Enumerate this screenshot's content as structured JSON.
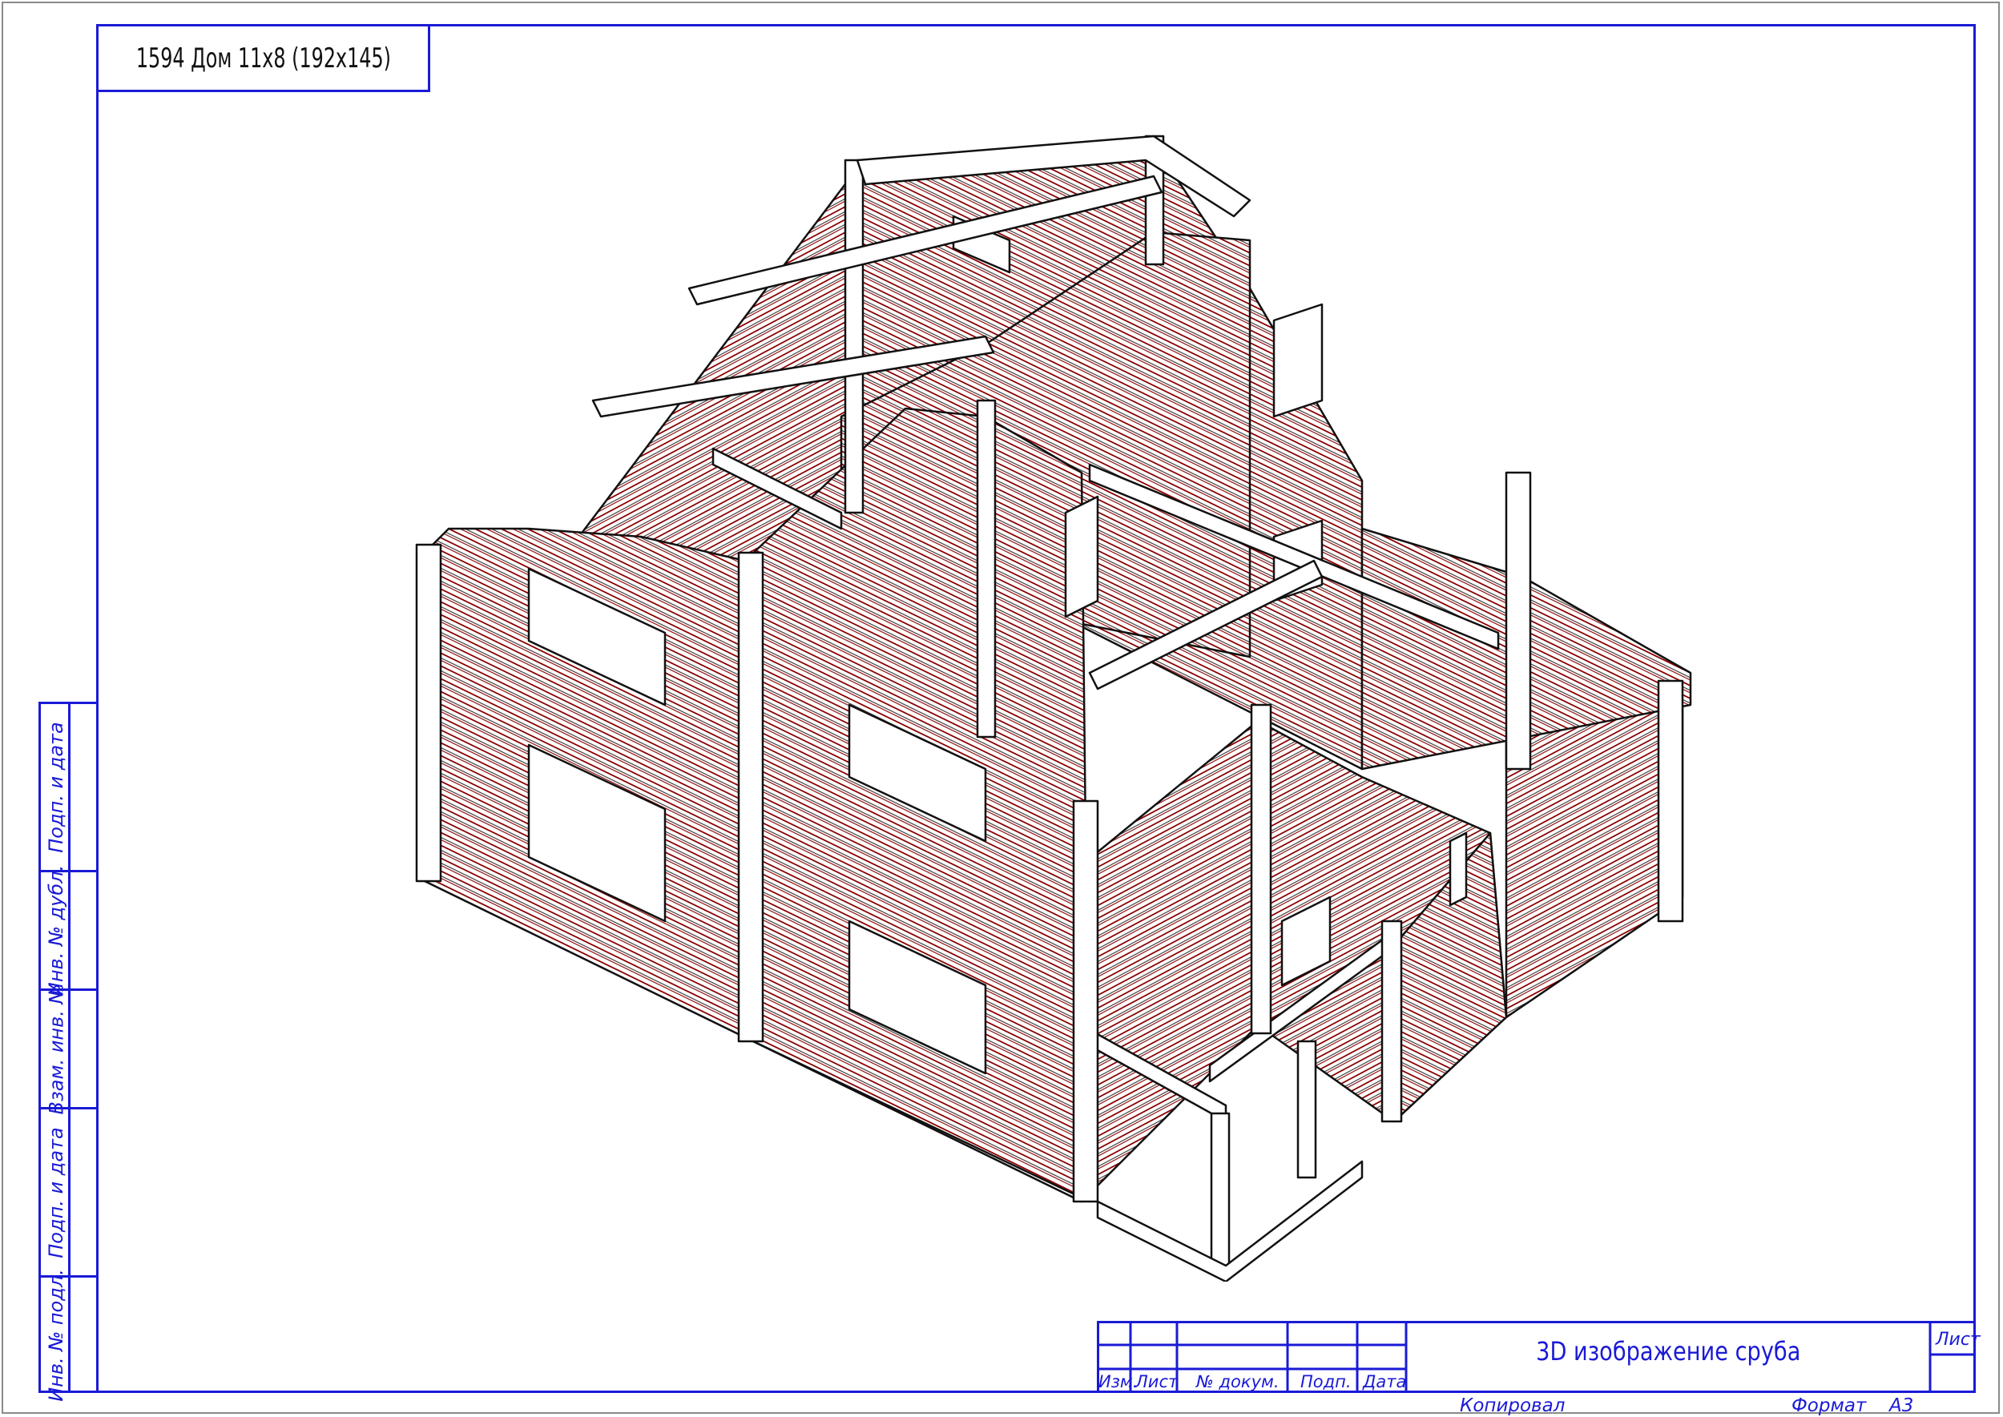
{
  "sheet": {
    "title": "1594 Дом 11х8 (192х145)",
    "drawing_name": "3D изображение сруба",
    "sheet_label": "Лист",
    "copied_label": "Копировал",
    "format_label": "Формат",
    "format_value": "А3"
  },
  "side_block": {
    "cells": [
      "Подп. и дата",
      "Инв. № дубл.",
      "Взам. инв. №",
      "Подп. и дата",
      "Инв. № подл."
    ]
  },
  "stamp": {
    "columns": [
      "Изм.",
      "Лист",
      "№ докум.",
      "Подп.",
      "Дата"
    ]
  },
  "colors": {
    "frame": "#1a1ad6",
    "log_line": "#8b0000",
    "outline": "#111111"
  }
}
